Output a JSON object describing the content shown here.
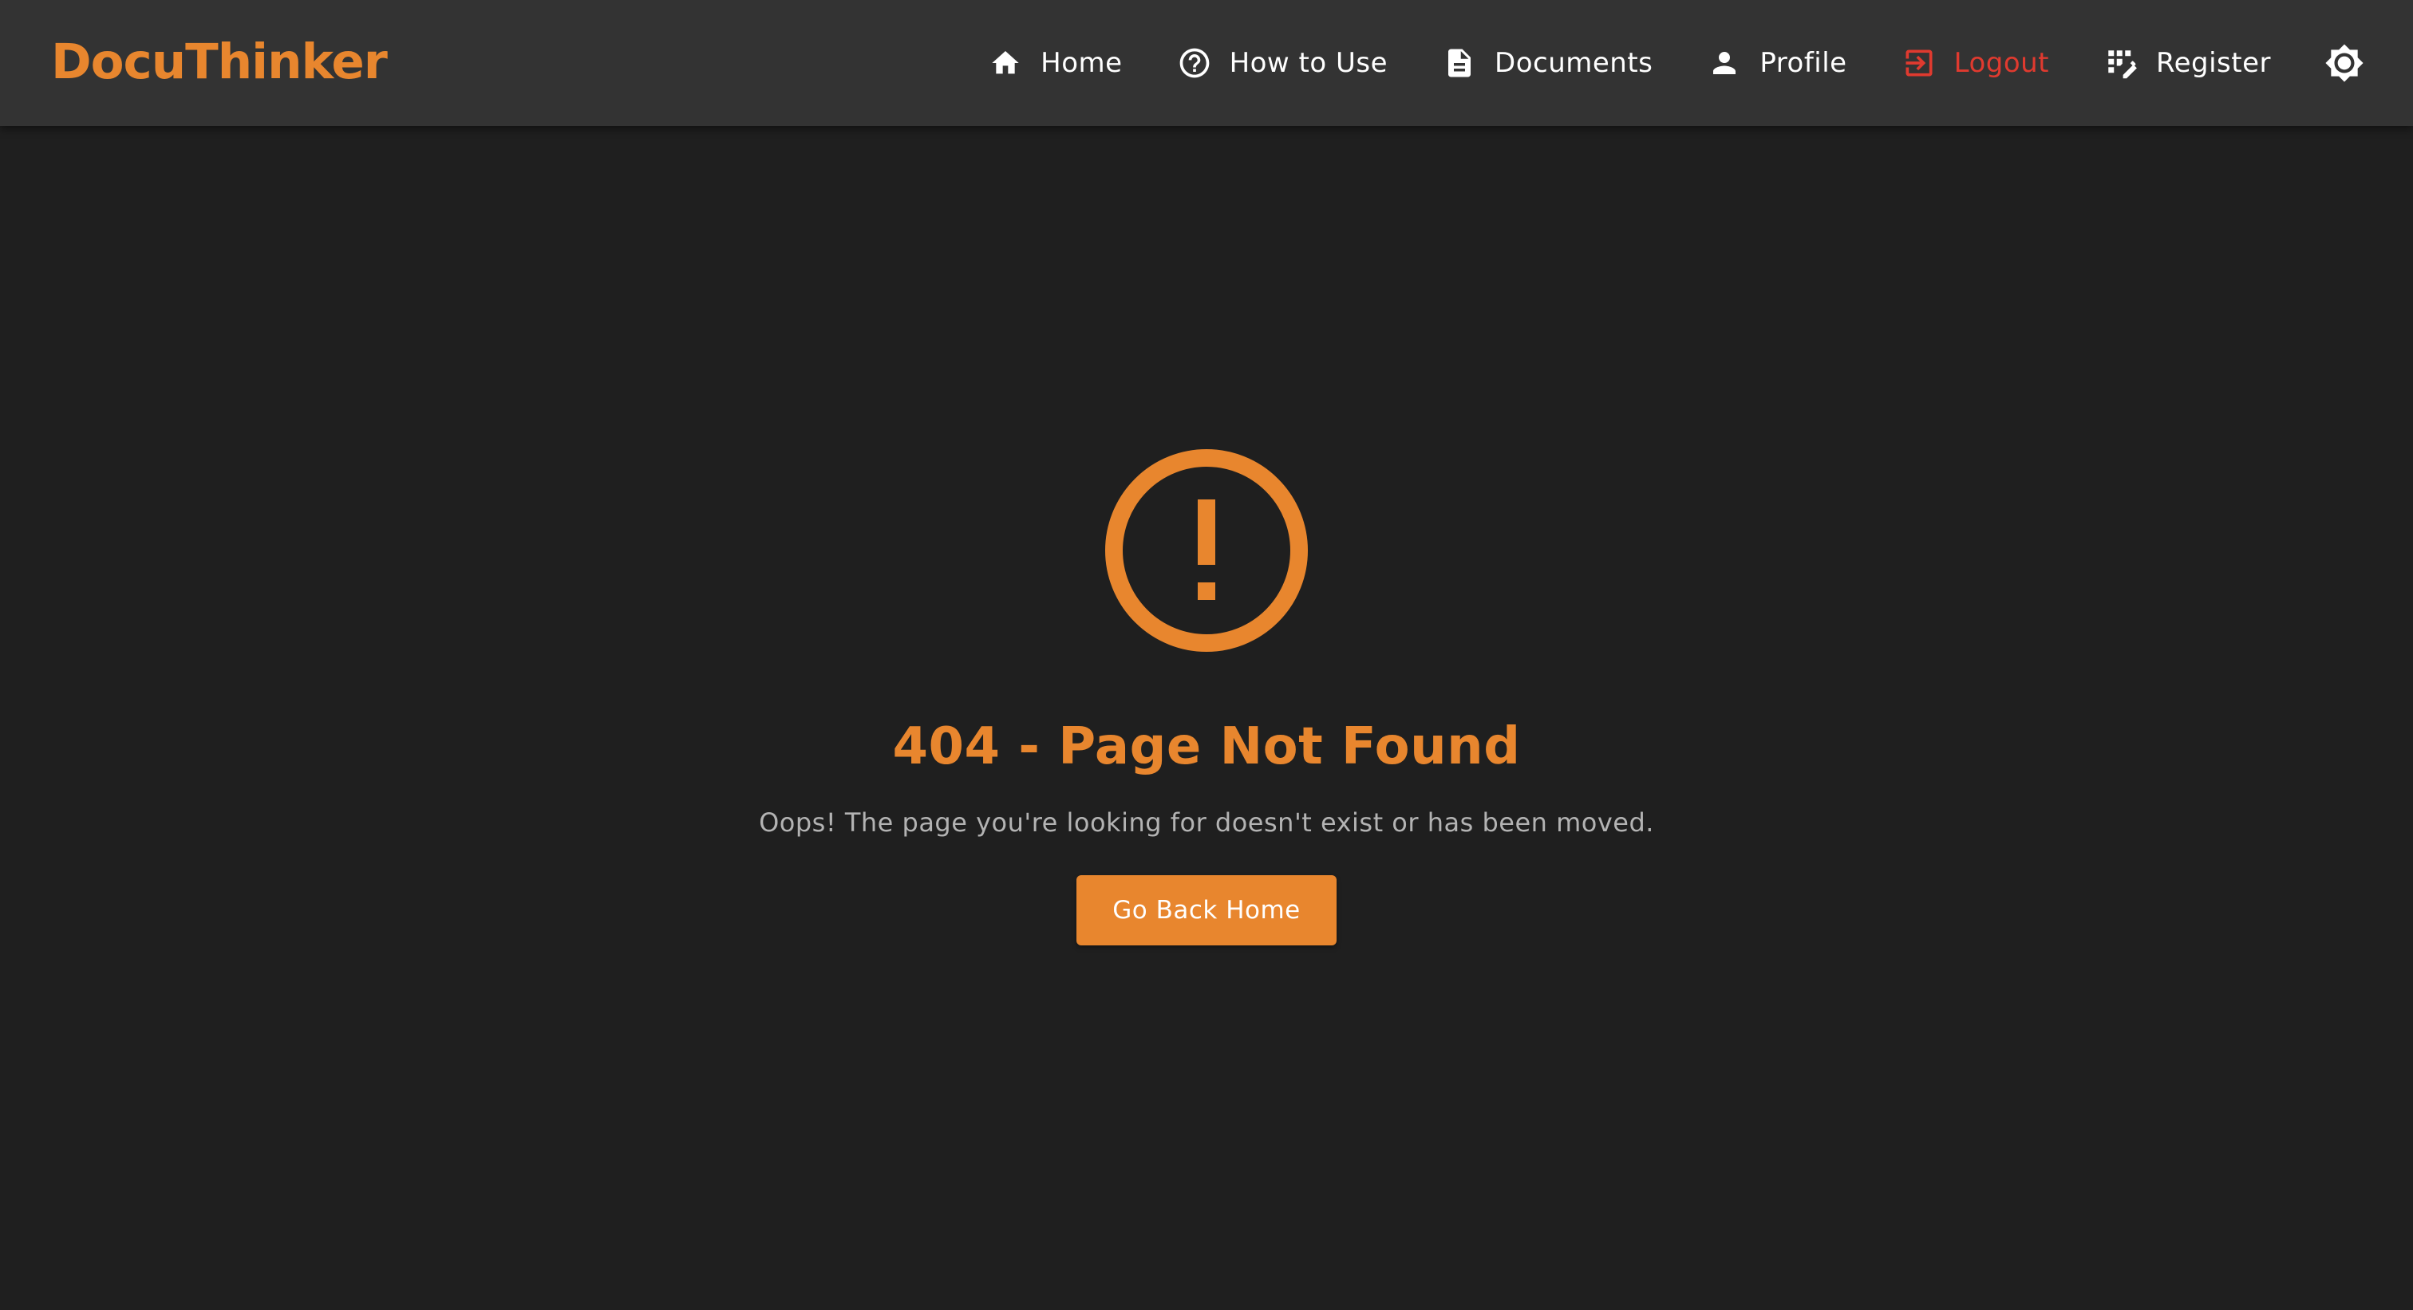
{
  "app": {
    "brand": "DocuThinker"
  },
  "nav": {
    "items": [
      {
        "label": "Home",
        "icon": "home-icon"
      },
      {
        "label": "How to Use",
        "icon": "help-circle-icon"
      },
      {
        "label": "Documents",
        "icon": "document-icon"
      },
      {
        "label": "Profile",
        "icon": "person-icon"
      },
      {
        "label": "Logout",
        "icon": "logout-icon"
      },
      {
        "label": "Register",
        "icon": "register-icon"
      }
    ],
    "theme_toggle_icon": "brightness-icon"
  },
  "error": {
    "icon": "error-outline-icon",
    "title": "404 - Page Not Found",
    "message": "Oops! The page you're looking for doesn't exist or has been moved.",
    "button_label": "Go Back Home"
  },
  "colors": {
    "accent": "#e8862e",
    "navbar_bg": "#333333",
    "page_bg": "#1f1f1f",
    "logout": "#e03a2f",
    "muted_text": "#b3b3b3"
  }
}
